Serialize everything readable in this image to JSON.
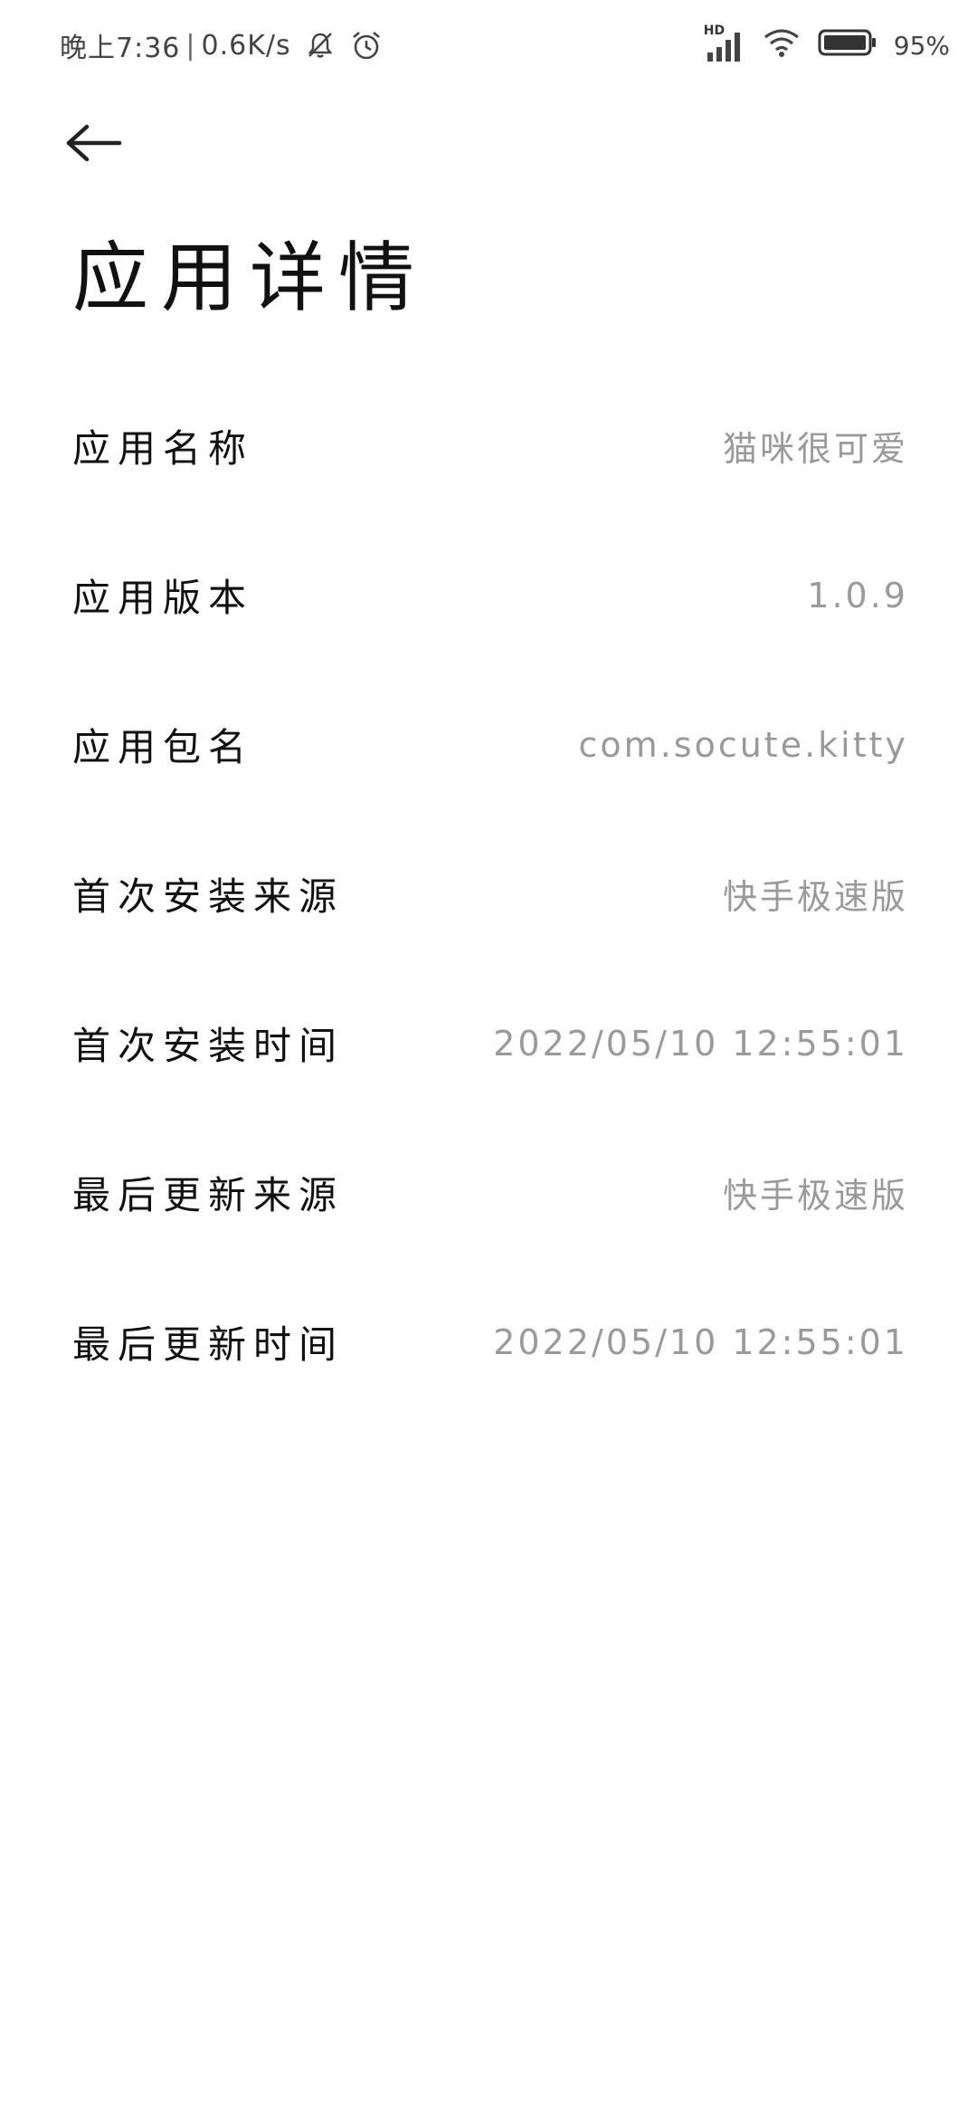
{
  "status_bar": {
    "time": "晚上7:36",
    "net_speed": "0.6K/s",
    "battery_percent": "95%",
    "signal_badge": "HD",
    "icons": [
      "mute-icon",
      "alarm-icon",
      "signal-icon",
      "wifi-icon",
      "battery-icon"
    ]
  },
  "page": {
    "title": "应用详情"
  },
  "rows": [
    {
      "label": "应用名称",
      "value": "猫咪很可爱"
    },
    {
      "label": "应用版本",
      "value": "1.0.9"
    },
    {
      "label": "应用包名",
      "value": "com.socute.kitty"
    },
    {
      "label": "首次安装来源",
      "value": "快手极速版"
    },
    {
      "label": "首次安装时间",
      "value": "2022/05/10 12:55:01"
    },
    {
      "label": "最后更新来源",
      "value": "快手极速版"
    },
    {
      "label": "最后更新时间",
      "value": "2022/05/10 12:55:01"
    }
  ],
  "colors": {
    "background": "#ffffff",
    "label_text": "#111111",
    "value_text": "#9a9a9a"
  }
}
